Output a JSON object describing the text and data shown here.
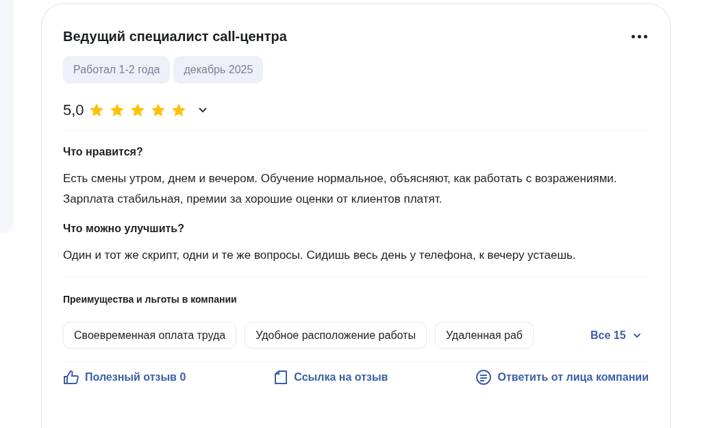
{
  "review": {
    "title": "Ведущий специалист call-центра",
    "tags": [
      "Работал 1-2 года",
      "декабрь 2025"
    ],
    "rating": "5,0",
    "stars": 5,
    "sections": [
      {
        "heading": "Что нравится?",
        "text": "Есть смены утром, днем и вечером. Обучение нормальное, объясняют, как работать с возражениями. Зарплата стабильная, премии за хорошие оценки от клиентов платят."
      },
      {
        "heading": "Что можно улучшить?",
        "text": "Один и тот же скрипт, одни и те же вопросы. Сидишь весь день у телефона, к вечеру устаешь."
      }
    ],
    "benefits": {
      "heading": "Преимущества и льготы в компании",
      "items": [
        "Своевременная оплата труда",
        "Удобное расположение работы",
        "Удаленная раб"
      ],
      "more": "Все 15"
    },
    "actions": [
      {
        "kind": "like",
        "label": "Полезный отзыв 0"
      },
      {
        "kind": "link",
        "label": "Ссылка на отзыв"
      },
      {
        "kind": "reply",
        "label": "Ответить от лица компании"
      }
    ]
  }
}
